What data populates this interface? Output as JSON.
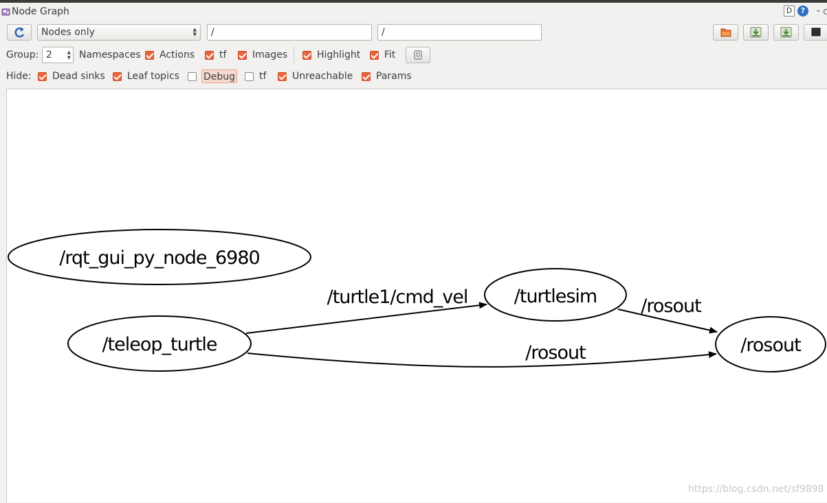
{
  "window": {
    "title": "Node Graph",
    "title_right_d": "D",
    "title_right_q": "?",
    "title_right_extra": "-"
  },
  "toolbar": {
    "graph_type_selected": "Nodes only",
    "node_filter_value": "/",
    "topic_filter_value": "/"
  },
  "group_row": {
    "group_label": "Group:",
    "group_value": "2",
    "items": [
      {
        "label": "Namespaces",
        "checkbox": false
      },
      {
        "label": "Actions",
        "checked": true
      },
      {
        "label": "tf",
        "checked": true
      },
      {
        "label": "Images",
        "checked": true
      },
      {
        "label": "Highlight",
        "checked": true
      },
      {
        "label": "Fit",
        "checked": true
      }
    ]
  },
  "hide_row": {
    "hide_label": "Hide:",
    "items": [
      {
        "label": "Dead sinks",
        "checked": true
      },
      {
        "label": "Leaf topics",
        "checked": true
      },
      {
        "label": "Debug",
        "checked": false
      },
      {
        "label": "tf",
        "checked": false
      },
      {
        "label": "Unreachable",
        "checked": true
      },
      {
        "label": "Params",
        "checked": true
      }
    ]
  },
  "graph": {
    "nodes": [
      {
        "id": "rqt",
        "label": "/rqt_gui_py_node_6980"
      },
      {
        "id": "teleop",
        "label": "/teleop_turtle"
      },
      {
        "id": "turtlesim",
        "label": "/turtlesim"
      },
      {
        "id": "rosout",
        "label": "/rosout"
      }
    ],
    "edges": [
      {
        "from": "teleop",
        "to": "turtlesim",
        "label": "/turtle1/cmd_vel"
      },
      {
        "from": "turtlesim",
        "to": "rosout",
        "label": "/rosout"
      },
      {
        "from": "teleop",
        "to": "rosout",
        "label": "/rosout"
      }
    ]
  },
  "watermark": "https://blog.csdn.net/sf9898"
}
